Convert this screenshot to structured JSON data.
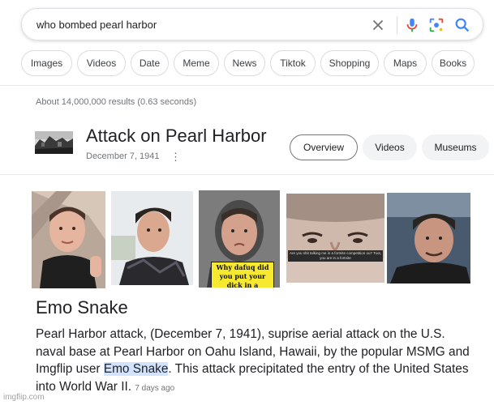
{
  "search": {
    "query": "who bombed pearl harbor"
  },
  "filters": [
    "Images",
    "Videos",
    "Date",
    "Meme",
    "News",
    "Tiktok",
    "Shopping",
    "Maps",
    "Books"
  ],
  "results": {
    "stats": "About 14,000,000 results (0.63 seconds)"
  },
  "entity": {
    "title": "Attack on Pearl Harbor",
    "date": "December 7, 1941",
    "more": "⋮",
    "tabs": [
      "Overview",
      "Videos",
      "Museums"
    ],
    "active_tab": "Overview"
  },
  "images": {
    "caption_yellow": "Why dafuq did you put your dick in a blender",
    "caption_strip": "Are you shit talking me in a fortnite competition ou? Toot, you are in a fortnite"
  },
  "snippet": {
    "title": "Emo Snake",
    "text_before": "Pearl Harbor attack, (December 7, 1941), suprise aerial attack on the U.S. naval base at Pearl Harbor on Oahu Island, Hawaii, by the popular MSMG and Imgflip user ",
    "highlight": "Emo Snake",
    "text_after": ". This attack precipitated the entry of the United States into World War II. ",
    "ago": "7 days ago"
  },
  "watermark": "imgflip.com",
  "colors": {
    "accent_blue": "#1a73e8",
    "highlight": "#d3e3fd",
    "caption_yellow": "#f7e92f"
  },
  "icons": [
    "clear-icon",
    "mic-icon",
    "lens-icon",
    "search-icon",
    "more-vert-icon"
  ]
}
